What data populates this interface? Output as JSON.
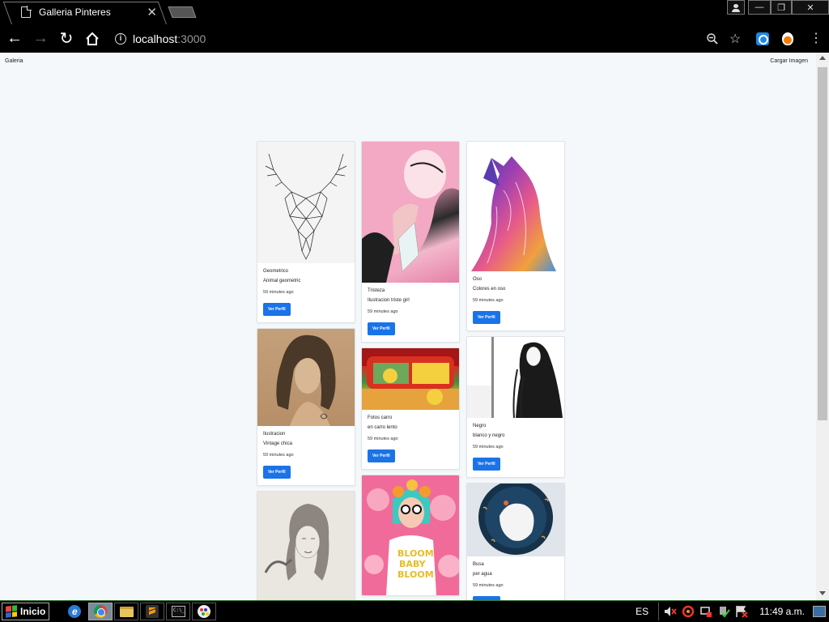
{
  "browser": {
    "tab_title": "Galleria Pinteres",
    "tab_close": "✕",
    "url_host": "localhost",
    "url_port": ":3000",
    "window_buttons": {
      "minimize": "—",
      "maximize": "❐",
      "close": "✕"
    }
  },
  "page": {
    "nav_left": "Galeria",
    "nav_right": "Cargar Imagen",
    "button_label": "Ver Perfil"
  },
  "cards": [
    {
      "title": "Geometrico",
      "description": "Animal geometric",
      "time": "59 minutes ago",
      "image": "deer-geometric"
    },
    {
      "title": "Ilustracion",
      "description": "Vintage chica",
      "time": "59 minutes ago",
      "image": "girl-hair-portrait"
    },
    {
      "title": "",
      "description": "",
      "time": "",
      "image": "pencil-sketch-woman"
    },
    {
      "title": "Tristeza",
      "description": "Ilustracion triste girl",
      "time": "59 minutes ago",
      "image": "pink-hair-girl"
    },
    {
      "title": "Fotos carro",
      "description": "en carro lento",
      "time": "59 minutes ago",
      "image": "simpsons-car"
    },
    {
      "title": "",
      "description": "",
      "time": "",
      "image": "bloom-baby-bloom"
    },
    {
      "title": "Oso",
      "description": "Colores en oso",
      "time": "59 minutes ago",
      "image": "colorful-wolf"
    },
    {
      "title": "Negro",
      "description": "blanco y negro",
      "time": "59 minutes ago",
      "image": "bw-girl-hair"
    },
    {
      "title": "Busa",
      "description": "per agua",
      "time": "59 minutes ago",
      "image": "space-astronaut"
    }
  ],
  "taskbar": {
    "start_label": "Inicio",
    "language": "ES",
    "clock": "11:49 a.m."
  },
  "colors": {
    "accent_button": "#1a73e8",
    "page_bg": "#f5f8fa"
  }
}
